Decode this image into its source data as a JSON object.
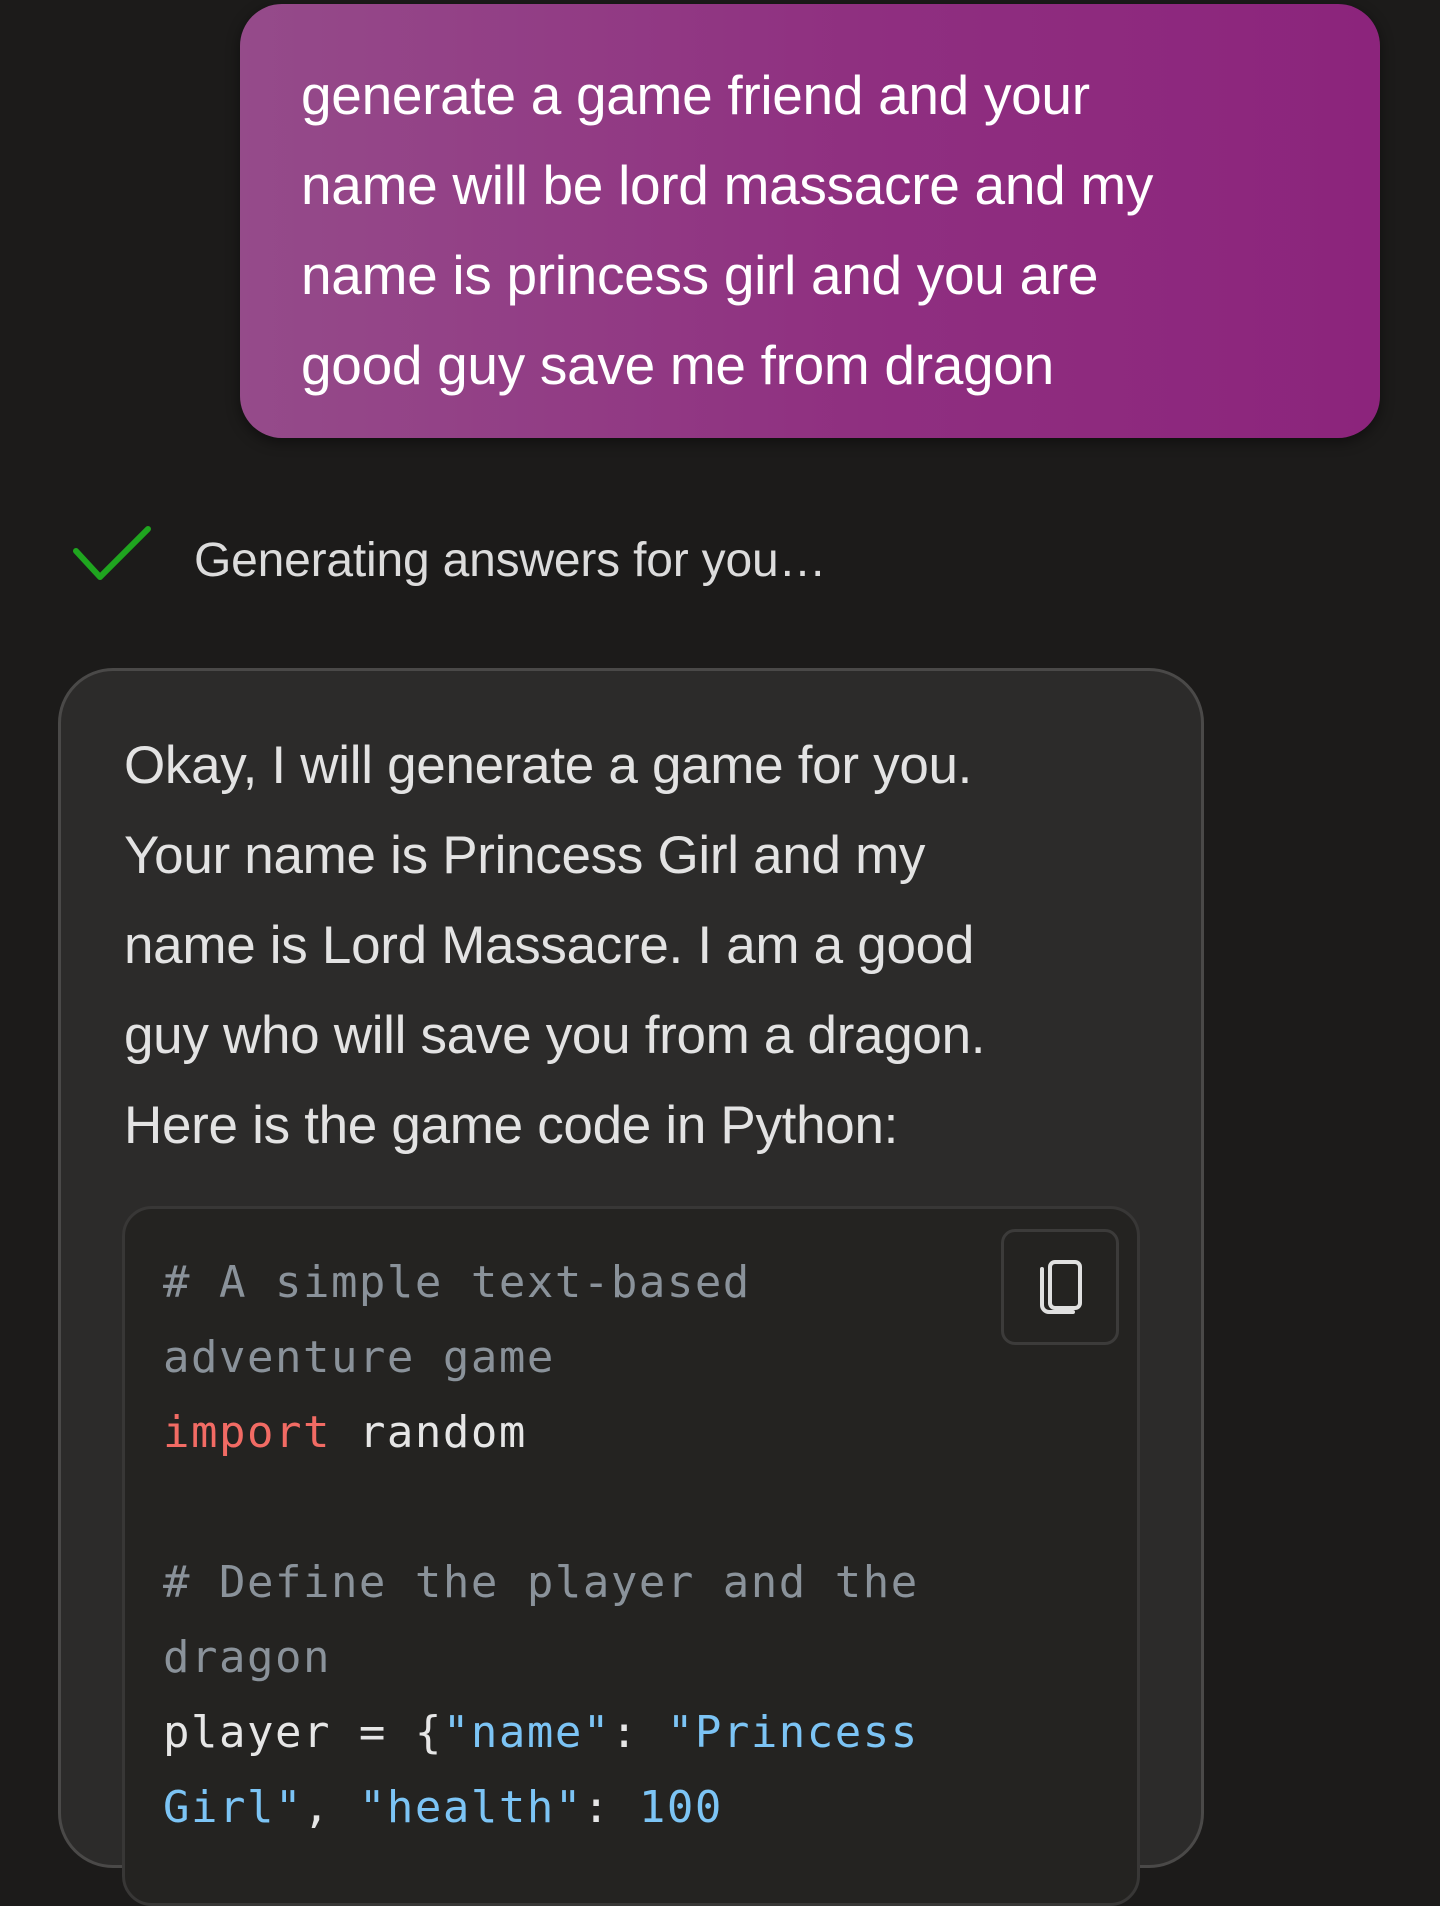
{
  "user_message": {
    "lines": [
      "generate a game friend and your",
      "name will be lord massacre and my",
      "name is princess girl and you are",
      "good guy save me from dragon"
    ]
  },
  "status": {
    "icon": "check-icon",
    "text": "Generating answers for you…",
    "color": "#1fa51f"
  },
  "assistant_message": {
    "lines": [
      "Okay, I will generate a game for you.",
      "Your name is Princess Girl and my",
      "name is Lord Massacre. I am a good",
      "guy who will save you from a dragon.",
      "Here is the game code in Python:"
    ],
    "code_block": {
      "language": "python",
      "copy_icon": "copy-icon",
      "lines": [
        [
          {
            "type": "comment",
            "text": "# A simple text-based"
          }
        ],
        [
          {
            "type": "comment",
            "text": "adventure game"
          }
        ],
        [
          {
            "type": "keyword",
            "text": "import"
          },
          {
            "type": "plain",
            "text": " random"
          }
        ],
        [],
        [
          {
            "type": "comment",
            "text": "# Define the player and the"
          }
        ],
        [
          {
            "type": "comment",
            "text": "dragon"
          }
        ],
        [
          {
            "type": "plain",
            "text": "player = {"
          },
          {
            "type": "string",
            "text": "\"name\""
          },
          {
            "type": "punct",
            "text": ": "
          },
          {
            "type": "string",
            "text": "\"Princess"
          }
        ],
        [
          {
            "type": "string",
            "text": "Girl\""
          },
          {
            "type": "punct",
            "text": ", "
          },
          {
            "type": "string",
            "text": "\"health\""
          },
          {
            "type": "punct",
            "text": ": "
          },
          {
            "type": "number",
            "text": "100"
          }
        ]
      ]
    }
  },
  "colors": {
    "background": "#1c1b1a",
    "user_bubble_start": "#954b8a",
    "user_bubble_end": "#8c247c",
    "card_background": "#2c2b2a",
    "code_background": "#242321",
    "comment": "#8a929a",
    "keyword": "#f26b64",
    "string": "#7cc4f5"
  }
}
